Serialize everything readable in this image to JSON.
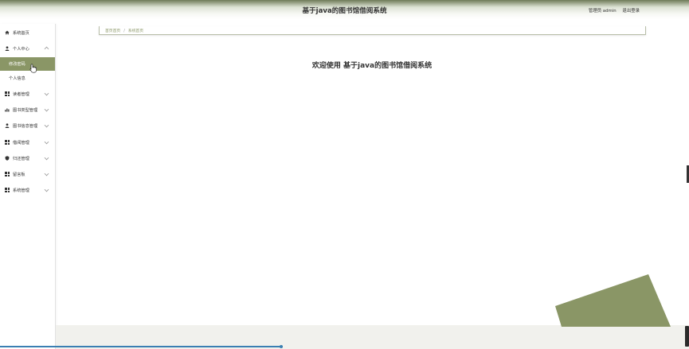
{
  "header": {
    "title": "基于java的图书馆借阅系统",
    "user_text": "管理员 admin",
    "logout_label": "退出登录"
  },
  "sidebar": {
    "items": [
      {
        "label": "系统首页",
        "icon": "home-icon"
      },
      {
        "label": "个人中心",
        "icon": "user-icon",
        "expanded": true,
        "children": [
          {
            "label": "修改密码",
            "active": true
          },
          {
            "label": "个人信息",
            "active": false
          }
        ]
      },
      {
        "label": "读者管理",
        "icon": "grid-icon"
      },
      {
        "label": "图书类型管理",
        "icon": "bar-chart-icon"
      },
      {
        "label": "图书信息管理",
        "icon": "user-icon"
      },
      {
        "label": "借阅管理",
        "icon": "grid-icon"
      },
      {
        "label": "归还管理",
        "icon": "shield-icon"
      },
      {
        "label": "留言板",
        "icon": "grid-icon"
      },
      {
        "label": "系统管理",
        "icon": "grid-icon"
      }
    ]
  },
  "breadcrumb": {
    "home": "首页首页",
    "separator": "/",
    "current": "系统首页"
  },
  "main": {
    "welcome": "欢迎使用 基于java的图书馆借阅系统"
  },
  "colors": {
    "accent": "#8a9666",
    "header_dark": "#6e7a57",
    "footer": "#f1f1ed",
    "scrollbar": "#3b7fb2"
  }
}
